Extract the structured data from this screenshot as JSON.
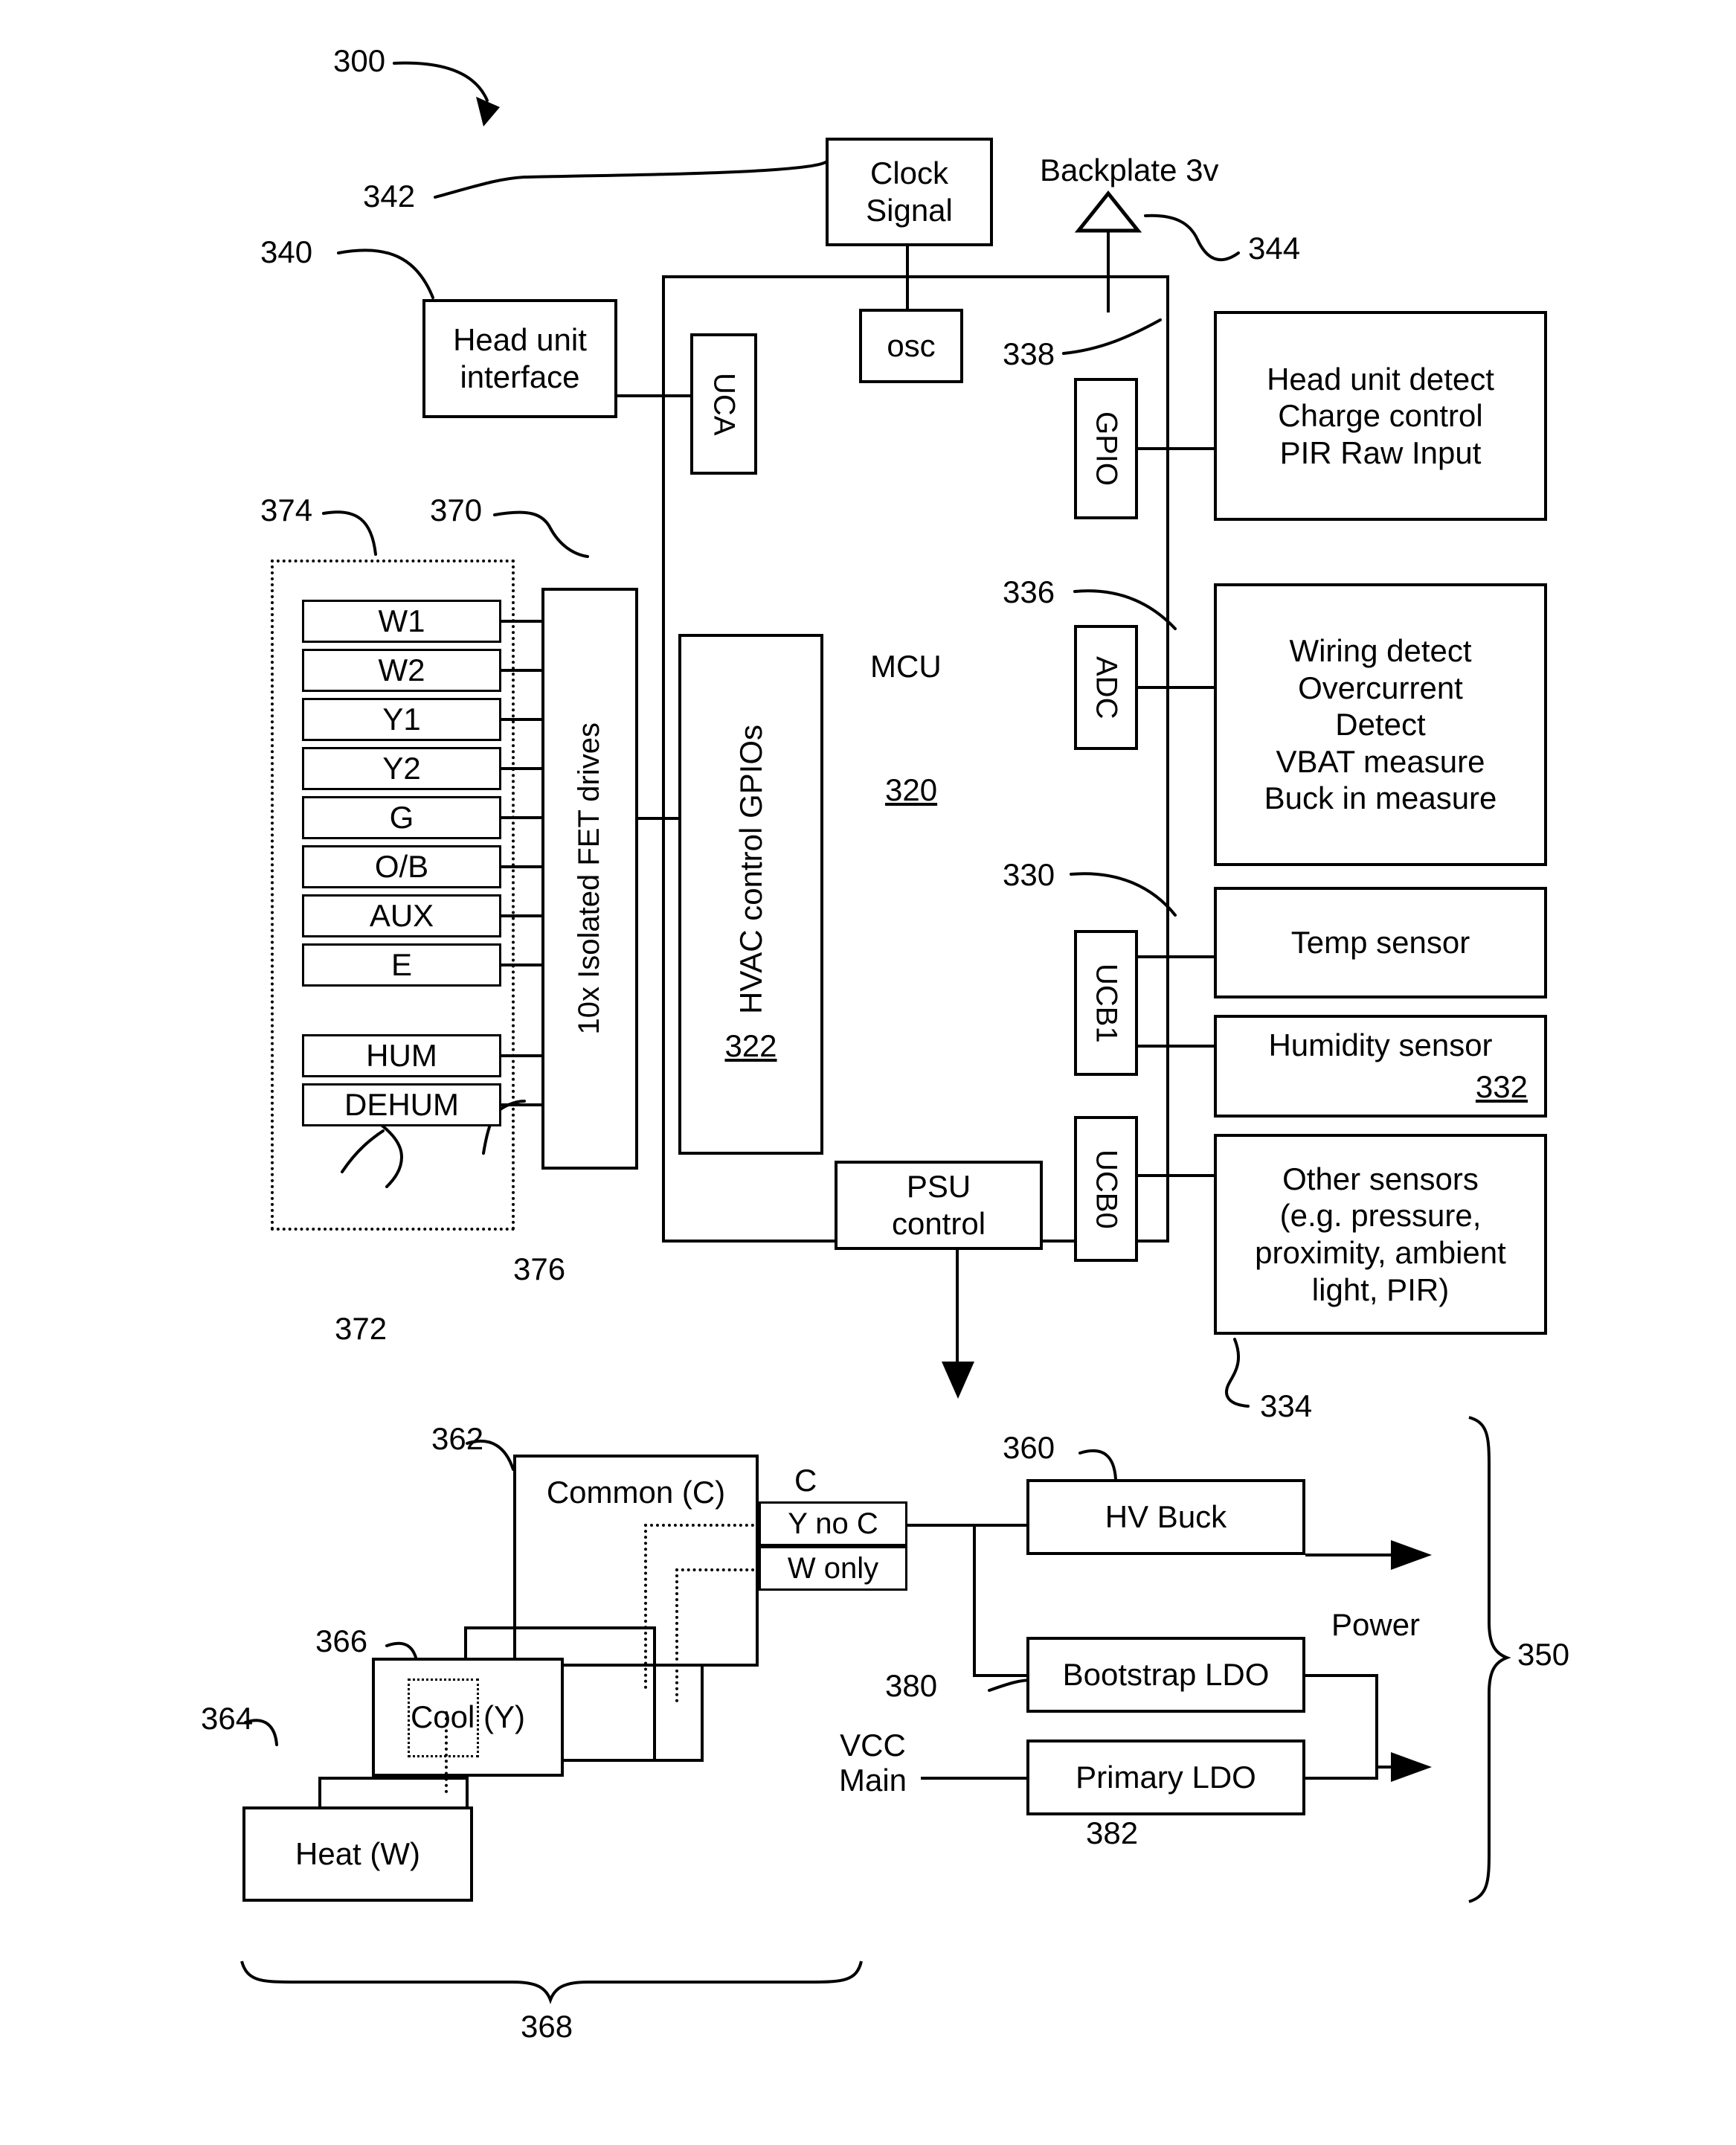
{
  "figure": {
    "label": "300",
    "title_ref": "300"
  },
  "refs": {
    "fig": "300",
    "mcu": "320",
    "hvac_gpios": "322",
    "temp_sensor": "330",
    "humidity_sensor": "332",
    "other_sensors": "334",
    "adc": "336",
    "gpio": "338",
    "head_unit": "340",
    "clock_signal": "342",
    "backplate": "344",
    "power_group": "350",
    "hv_buck": "360",
    "common": "362",
    "heat": "364",
    "cool": "366",
    "wiring_group": "368",
    "fet_group": "370",
    "terminal_group_lower": "372",
    "terminal_group_upper": "374",
    "fet_drives": "376",
    "bootstrap_ldo": "380",
    "primary_ldo": "382"
  },
  "blocks": {
    "clock_signal": "Clock\nSignal",
    "clock_signal_l1": "Clock",
    "clock_signal_l2": "Signal",
    "backplate_label": "Backplate 3v",
    "head_unit_l1": "Head unit",
    "head_unit_l2": "interface",
    "uca": "UCA",
    "osc": "osc",
    "gpio": "GPIO",
    "adc": "ADC",
    "ucb1": "UCB1",
    "ucb0": "UCB0",
    "mcu_name": "MCU",
    "mcu_ref": "320",
    "hvac_gpios": "HVAC control GPIOs",
    "hvac_gpios_ref": "322",
    "fet_drives": "10x Isolated FET drives",
    "psu_control_l1": "PSU",
    "psu_control_l2": "control",
    "gpio_functions": [
      "Head unit detect",
      "Charge control",
      "PIR Raw Input"
    ],
    "adc_functions": [
      "Wiring detect",
      "Overcurrent",
      "Detect",
      "VBAT measure",
      "Buck in measure"
    ],
    "temp_sensor": "Temp sensor",
    "humidity_sensor": "Humidity sensor",
    "humidity_sensor_ref": "332",
    "other_sensors": [
      "Other sensors",
      "(e.g. pressure,",
      "proximity, ambient",
      "light, PIR)"
    ],
    "common": "Common (C)",
    "cool": "Cool (Y)",
    "heat": "Heat (W)",
    "c_label": "C",
    "y_no_c": "Y no C",
    "w_only": "W only",
    "hv_buck": "HV Buck",
    "bootstrap_ldo": "Bootstrap LDO",
    "primary_ldo": "Primary LDO",
    "power_label": "Power",
    "vcc_main_l1": "VCC",
    "vcc_main_l2": "Main"
  },
  "terminals": [
    {
      "label": "W1"
    },
    {
      "label": "W2"
    },
    {
      "label": "Y1"
    },
    {
      "label": "Y2"
    },
    {
      "label": "G"
    },
    {
      "label": "O/B"
    },
    {
      "label": "AUX"
    },
    {
      "label": "E"
    },
    {
      "label": "HUM"
    },
    {
      "label": "DEHUM"
    }
  ],
  "colors": {
    "ink": "#000000",
    "paper": "#ffffff"
  }
}
